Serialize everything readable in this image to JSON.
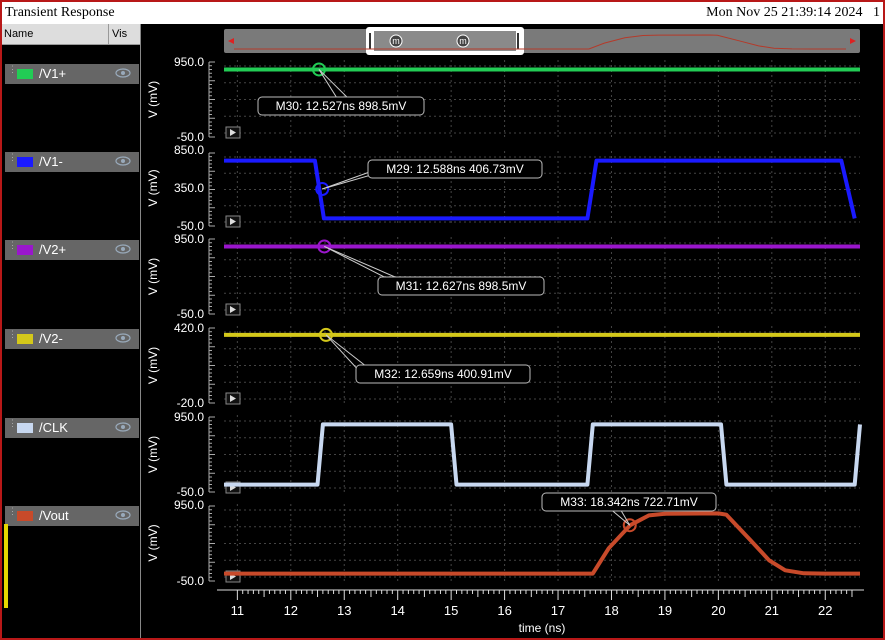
{
  "window": {
    "title": "Transient Response",
    "datetime": "Mon Nov 25 21:39:14 2024",
    "page_num": "1"
  },
  "panel": {
    "name_header": "Name",
    "vis_header": "Vis",
    "signals": [
      {
        "label": "/V1+",
        "color": "#22cc55"
      },
      {
        "label": "/V1-",
        "color": "#1a1aff"
      },
      {
        "label": "/V2+",
        "color": "#9a16cc"
      },
      {
        "label": "/V2-",
        "color": "#d4c81a"
      },
      {
        "label": "/CLK",
        "color": "#c8d8f0"
      },
      {
        "label": "/Vout",
        "color": "#c84a2a"
      }
    ]
  },
  "chart_data": {
    "type": "line",
    "xlabel": "time (ns)",
    "xlim": [
      10.75,
      22.65
    ],
    "xticks": [
      "11",
      "12",
      "13",
      "14",
      "15",
      "16",
      "17",
      "18",
      "19",
      "20",
      "21",
      "22"
    ],
    "ylabel": "V (mV)",
    "grid": true,
    "subplots": [
      {
        "name": "/V1+",
        "color": "#22cc55",
        "ylim": [
          -50,
          950
        ],
        "yticks": [
          "950.0",
          "-50.0"
        ],
        "x": [
          10.75,
          22.65
        ],
        "y": [
          898.5,
          898.5
        ],
        "marker": {
          "label": "M30: 12.527ns 898.5mV",
          "x": 12.527,
          "y": 898.5
        }
      },
      {
        "name": "/V1-",
        "color": "#1a1aff",
        "ylim": [
          -50,
          850
        ],
        "yticks": [
          "850.0",
          "350.0",
          "-50.0"
        ],
        "x": [
          10.75,
          12.45,
          12.62,
          17.55,
          17.72,
          22.3,
          22.55
        ],
        "y": [
          800,
          800,
          0,
          0,
          800,
          800,
          0
        ],
        "marker": {
          "label": "M29: 12.588ns 406.73mV",
          "x": 12.588,
          "y": 406.73
        }
      },
      {
        "name": "/V2+",
        "color": "#9a16cc",
        "ylim": [
          -50,
          950
        ],
        "yticks": [
          "950.0",
          "-50.0"
        ],
        "x": [
          10.75,
          22.65
        ],
        "y": [
          898.5,
          898.5
        ],
        "marker": {
          "label": "M31: 12.627ns 898.5mV",
          "x": 12.627,
          "y": 898.5
        }
      },
      {
        "name": "/V2-",
        "color": "#d4c81a",
        "ylim": [
          -20,
          420
        ],
        "yticks": [
          "420.0",
          "-20.0"
        ],
        "x": [
          10.75,
          22.65
        ],
        "y": [
          400.91,
          400.91
        ],
        "marker": {
          "label": "M32: 12.659ns 400.91mV",
          "x": 12.659,
          "y": 400.91
        }
      },
      {
        "name": "/CLK",
        "color": "#c8d8f0",
        "ylim": [
          -50,
          950
        ],
        "yticks": [
          "950.0",
          "-50.0"
        ],
        "x": [
          10.75,
          12.5,
          12.6,
          15.0,
          15.1,
          17.55,
          17.65,
          20.05,
          20.15,
          22.55,
          22.65
        ],
        "y": [
          0,
          0,
          900,
          900,
          0,
          0,
          900,
          900,
          0,
          0,
          900
        ],
        "marker": null
      },
      {
        "name": "/Vout",
        "color": "#c84a2a",
        "ylim": [
          -50,
          950
        ],
        "yticks": [
          "950.0",
          "-50.0"
        ],
        "x": [
          10.75,
          17.65,
          17.95,
          18.35,
          18.7,
          19.0,
          20.0,
          20.15,
          20.6,
          20.95,
          21.25,
          21.6,
          22.0,
          22.65
        ],
        "y": [
          0,
          0,
          380,
          722.71,
          870,
          895,
          900,
          880,
          500,
          200,
          50,
          5,
          0,
          0
        ],
        "marker": {
          "label": "M33: 18.342ns 722.71mV",
          "x": 18.342,
          "y": 722.71
        }
      }
    ]
  },
  "overview": {
    "marker_glyph": "m"
  }
}
